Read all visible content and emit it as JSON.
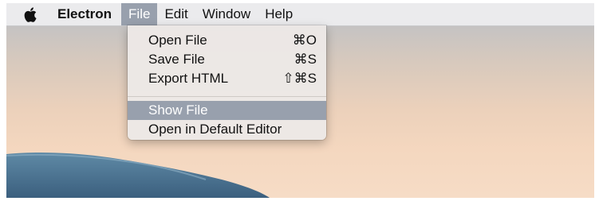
{
  "menubar": {
    "app_name": "Electron",
    "menus": [
      "File",
      "Edit",
      "Window",
      "Help"
    ]
  },
  "file_menu": {
    "items": [
      {
        "label": "Open File",
        "shortcut": "⌘O"
      },
      {
        "label": "Save File",
        "shortcut": "⌘S"
      },
      {
        "label": "Export HTML",
        "shortcut": "⇧⌘S"
      },
      {
        "label": "Show File",
        "shortcut": ""
      },
      {
        "label": "Open in Default Editor",
        "shortcut": ""
      }
    ],
    "highlighted_label": "Show File"
  },
  "colors": {
    "menu_highlight": "#98a0ad",
    "menubar_bg": "#ececee"
  },
  "icons": {
    "apple": "apple-logo-icon"
  }
}
